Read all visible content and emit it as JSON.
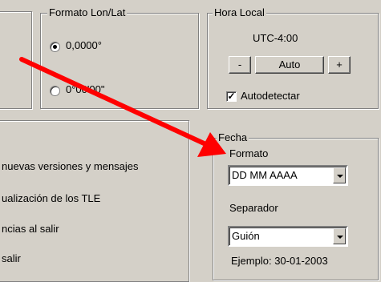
{
  "formato_lonlat": {
    "legend": "Formato Lon/Lat",
    "option1": "0,0000°",
    "option2": "0°00'00\""
  },
  "hora_local": {
    "legend": "Hora Local",
    "value": "UTC-4:00",
    "minus": "-",
    "auto": "Auto",
    "plus": "+",
    "autodetect": "Autodetectar"
  },
  "left_list": {
    "items": [
      "nuevas versiones y mensajes",
      "ualización de los TLE",
      "ncias al salir",
      "salir"
    ]
  },
  "fecha": {
    "legend": "Fecha",
    "formato_label": "Formato",
    "formato_value": "DD MM AAAA",
    "separador_label": "Separador",
    "separador_value": "Guión",
    "ejemplo": "Ejemplo: 30-01-2003"
  },
  "colors": {
    "arrow": "#ff0000"
  }
}
